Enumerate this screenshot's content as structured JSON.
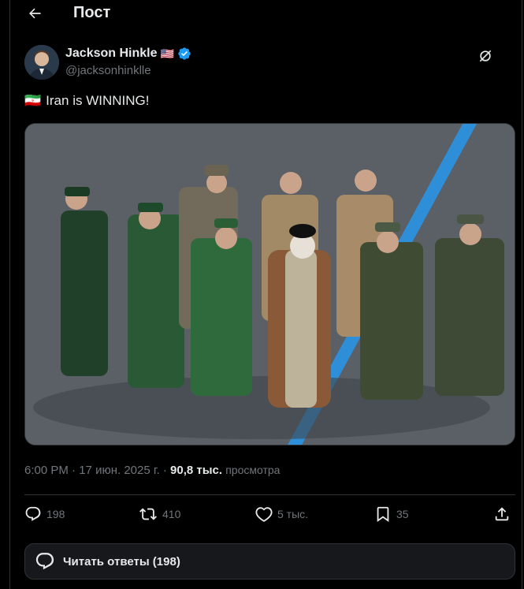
{
  "header": {
    "title": "Пост"
  },
  "author": {
    "name": "Jackson Hinkle",
    "flag_emoji": "🇺🇸",
    "handle": "@jacksonhinklle",
    "verified_color": "#1d9bf0"
  },
  "tweet": {
    "flag_emoji": "🇮🇷",
    "text": "Iran is WINNING!",
    "media_description": "photo"
  },
  "meta": {
    "time": "6:00 PM",
    "date": "17 июн. 2025 г.",
    "views_count": "90,8 тыс.",
    "views_label": "просмотра"
  },
  "actions": {
    "replies": "198",
    "reposts": "410",
    "likes": "5 тыс.",
    "bookmarks": "35"
  },
  "replies_bar": {
    "label": "Читать ответы (198)"
  },
  "colors": {
    "background": "#000000",
    "text": "#e7e9ea",
    "secondary": "#71767b",
    "accent": "#1d9bf0"
  }
}
